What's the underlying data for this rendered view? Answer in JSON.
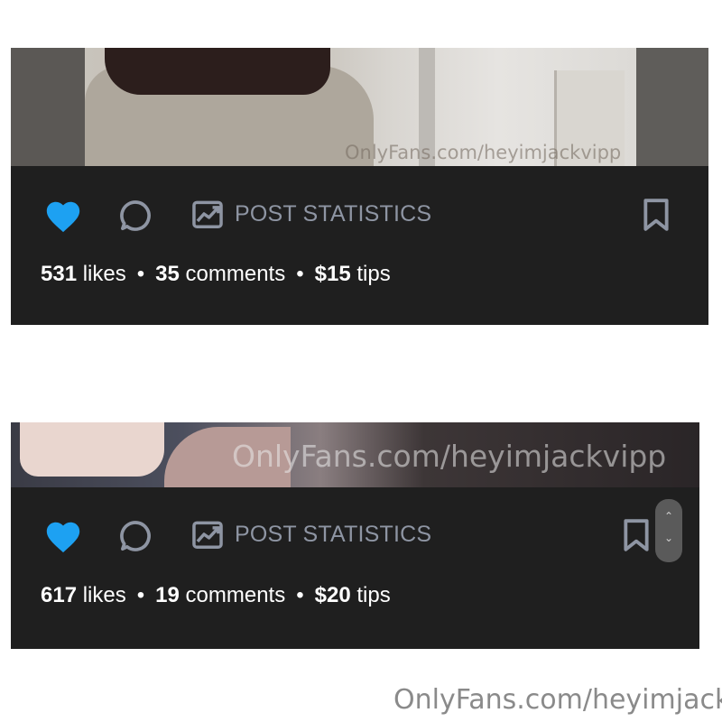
{
  "colors": {
    "like": "#1da1f2",
    "action_text": "#8e95a3",
    "card_bg": "#1f1f1f"
  },
  "posts": [
    {
      "watermark": "OnlyFans.com/heyimjackvipp",
      "actions": {
        "like_icon": "heart-filled-icon",
        "comment_icon": "comment-icon",
        "stats_icon": "chart-icon",
        "stats_label": "POST STATISTICS",
        "bookmark_icon": "bookmark-icon"
      },
      "likes": "531",
      "likes_label": "likes",
      "comments": "35",
      "comments_label": "comments",
      "tips": "$15",
      "tips_label": "tips"
    },
    {
      "watermark": "OnlyFans.com/heyimjackvipp",
      "actions": {
        "like_icon": "heart-filled-icon",
        "comment_icon": "comment-icon",
        "stats_icon": "chart-icon",
        "stats_label": "POST STATISTICS",
        "bookmark_icon": "bookmark-icon"
      },
      "likes": "617",
      "likes_label": "likes",
      "comments": "19",
      "comments_label": "comments",
      "tips": "$20",
      "tips_label": "tips"
    }
  ],
  "separator": "•",
  "scroll_arrows": {
    "up": "⌃",
    "down": "⌄"
  },
  "footer_watermark": "OnlyFans.com/heyimjack"
}
